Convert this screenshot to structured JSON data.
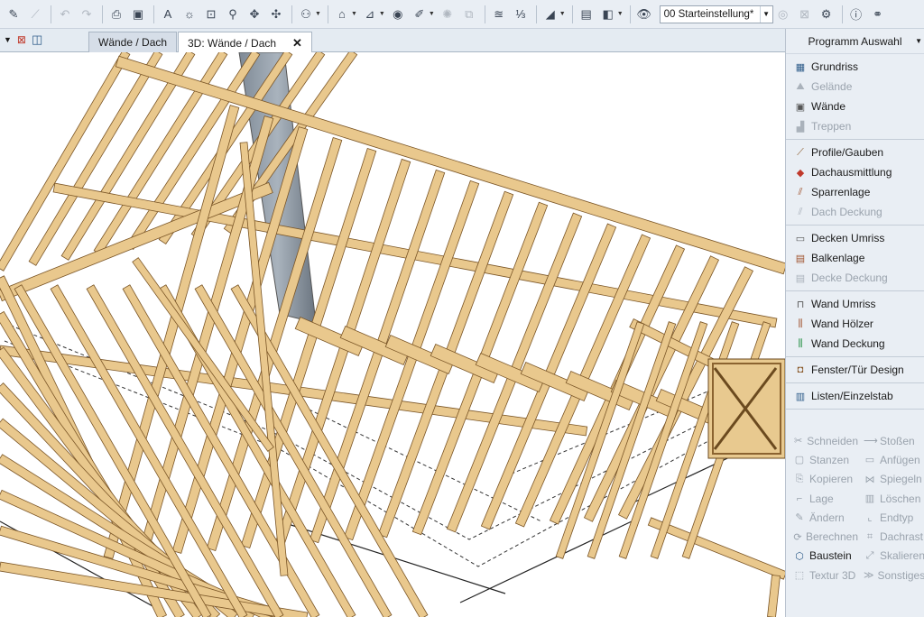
{
  "toolbar": {
    "view_value": "00 Starteinstellung*"
  },
  "tabs": [
    {
      "label": "Wände / Dach",
      "active": false
    },
    {
      "label": "3D: Wände / Dach",
      "active": true
    }
  ],
  "panel": {
    "title": "Programm Auswahl",
    "groups": [
      [
        {
          "label": "Grundriss",
          "enabled": true,
          "icon": "floorplan-icon"
        },
        {
          "label": "Gelände",
          "enabled": false,
          "icon": "terrain-icon"
        },
        {
          "label": "Wände",
          "enabled": true,
          "icon": "wall-icon"
        },
        {
          "label": "Treppen",
          "enabled": false,
          "icon": "stairs-icon"
        }
      ],
      [
        {
          "label": "Profile/Gauben",
          "enabled": true,
          "icon": "profile-icon"
        },
        {
          "label": "Dachausmittlung",
          "enabled": true,
          "icon": "roof-layout-icon"
        },
        {
          "label": "Sparrenlage",
          "enabled": true,
          "icon": "rafter-icon"
        },
        {
          "label": "Dach Deckung",
          "enabled": false,
          "icon": "roof-cover-icon"
        }
      ],
      [
        {
          "label": "Decken Umriss",
          "enabled": true,
          "icon": "ceiling-outline-icon"
        },
        {
          "label": "Balkenlage",
          "enabled": true,
          "icon": "beam-icon"
        },
        {
          "label": "Decke Deckung",
          "enabled": false,
          "icon": "ceiling-cover-icon"
        }
      ],
      [
        {
          "label": "Wand Umriss",
          "enabled": true,
          "icon": "wall-outline-icon"
        },
        {
          "label": "Wand Hölzer",
          "enabled": true,
          "icon": "wall-timber-icon"
        },
        {
          "label": "Wand Deckung",
          "enabled": true,
          "icon": "wall-cover-icon"
        }
      ],
      [
        {
          "label": "Fenster/Tür Design",
          "enabled": true,
          "icon": "window-door-icon"
        }
      ],
      [
        {
          "label": "Listen/Einzelstab",
          "enabled": true,
          "icon": "list-icon"
        }
      ]
    ],
    "tools": [
      [
        {
          "label": "Schneiden",
          "enabled": false
        },
        {
          "label": "Stoßen",
          "enabled": false
        }
      ],
      [
        {
          "label": "Stanzen",
          "enabled": false
        },
        {
          "label": "Anfügen",
          "enabled": false
        }
      ],
      [
        {
          "label": "Kopieren",
          "enabled": false
        },
        {
          "label": "Spiegeln",
          "enabled": false
        }
      ],
      [
        {
          "label": "Lage",
          "enabled": false
        },
        {
          "label": "Löschen",
          "enabled": false
        }
      ],
      [
        {
          "label": "Ändern",
          "enabled": false
        },
        {
          "label": "Endtyp",
          "enabled": false
        }
      ],
      [
        {
          "label": "Berechnen",
          "enabled": false
        },
        {
          "label": "Dachrast",
          "enabled": false
        }
      ],
      [
        {
          "label": "Baustein",
          "enabled": true
        },
        {
          "label": "Skalieren",
          "enabled": false
        }
      ],
      [
        {
          "label": "Textur 3D",
          "enabled": false
        },
        {
          "label": "Sonstiges",
          "enabled": false
        }
      ]
    ]
  }
}
